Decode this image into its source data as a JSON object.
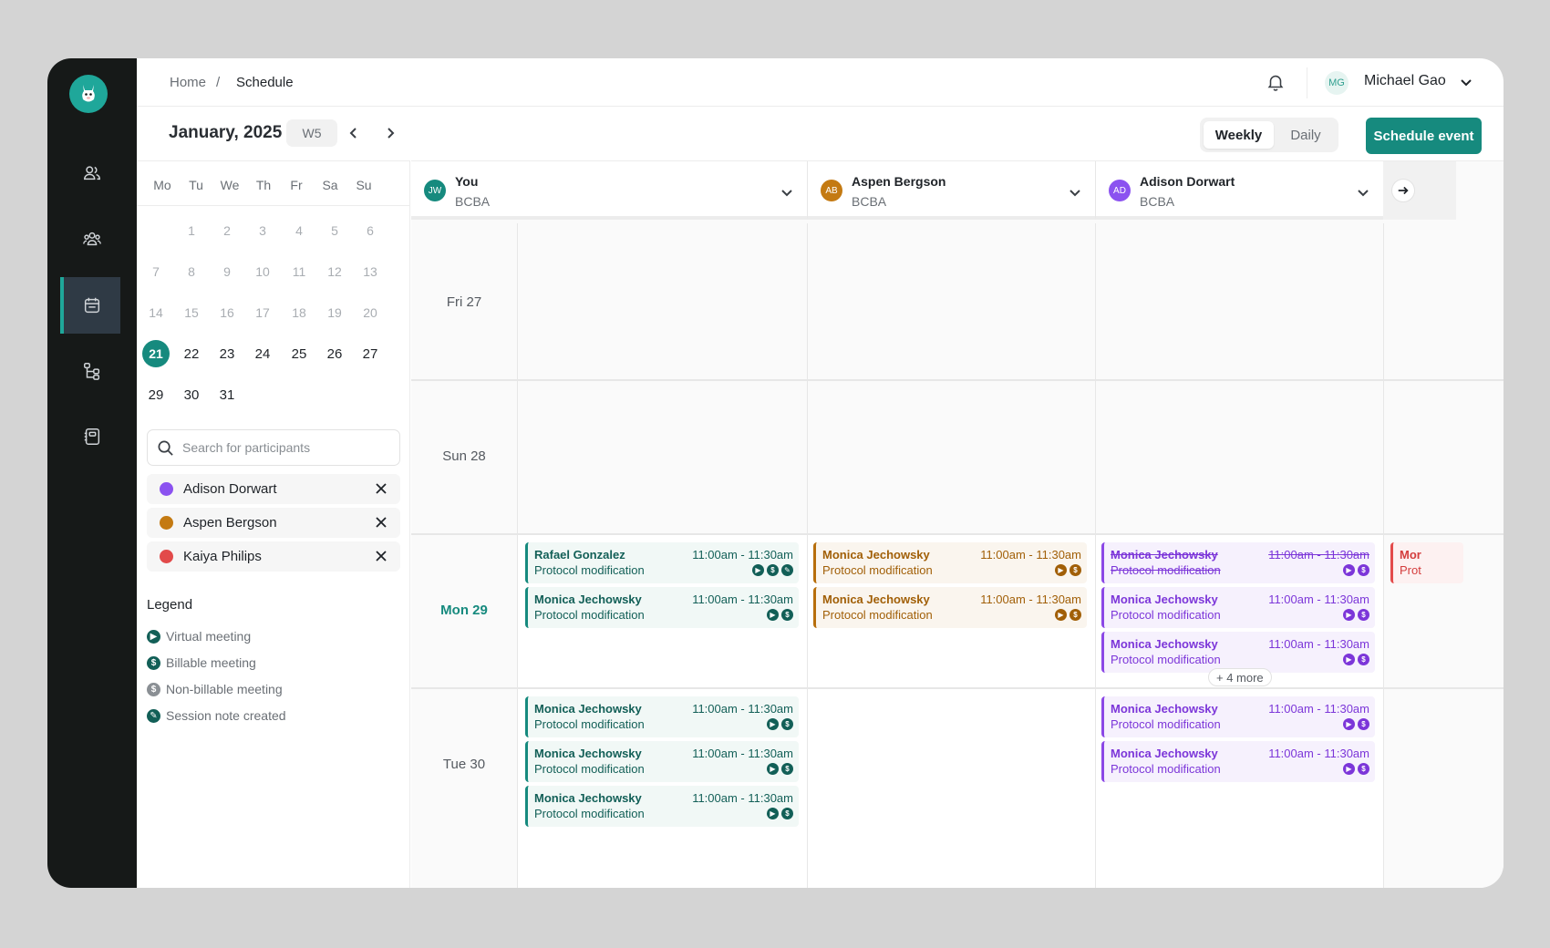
{
  "breadcrumb": {
    "home": "Home",
    "separator": "/",
    "current": "Schedule"
  },
  "user": {
    "initials": "MG",
    "name": "Michael Gao"
  },
  "toolbar": {
    "month": "January, 2025",
    "week": "W5",
    "view_weekly": "Weekly",
    "view_daily": "Daily",
    "schedule_button": "Schedule event"
  },
  "mini_calendar": {
    "weekdays": [
      "Mo",
      "Tu",
      "We",
      "Th",
      "Fr",
      "Sa",
      "Su"
    ],
    "past_days": [
      "1",
      "2",
      "3",
      "4",
      "5",
      "6",
      "7",
      "8",
      "9",
      "10",
      "11",
      "12",
      "13",
      "14",
      "15",
      "16",
      "17",
      "18",
      "19",
      "20"
    ],
    "selected_day": "21",
    "current_days": [
      "22",
      "23",
      "24",
      "25",
      "26",
      "27",
      "29",
      "30",
      "31"
    ]
  },
  "search": {
    "placeholder": "Search for participants"
  },
  "participants": [
    {
      "name": "Adison Dorwart",
      "color": "#8b52f0"
    },
    {
      "name": "Aspen Bergson",
      "color": "#c47a12"
    },
    {
      "name": "Kaiya Philips",
      "color": "#e24a4a"
    }
  ],
  "legend": {
    "title": "Legend",
    "items": [
      "Virtual meeting",
      "Billable meeting",
      "Non-billable meeting",
      "Session note created"
    ]
  },
  "columns": [
    {
      "initials": "JW",
      "name": "You",
      "role": "BCBA",
      "color": "#168a7e"
    },
    {
      "initials": "AB",
      "name": "Aspen Bergson",
      "role": "BCBA",
      "color": "#c47a12"
    },
    {
      "initials": "AD",
      "name": "Adison Dorwart",
      "role": "BCBA",
      "color": "#8b52f0"
    }
  ],
  "dates": [
    "Fri 27",
    "Sun 28",
    "Mon 29",
    "Tue 30"
  ],
  "events": {
    "you_mon_1": {
      "name": "Rafael Gonzalez",
      "desc": "Protocol modification",
      "time": "11:00am - 11:30am"
    },
    "you_mon_2": {
      "name": "Monica Jechowsky",
      "desc": "Protocol modification",
      "time": "11:00am - 11:30am"
    },
    "aspen_mon_1": {
      "name": "Monica Jechowsky",
      "desc": "Protocol modification",
      "time": "11:00am - 11:30am"
    },
    "aspen_mon_2": {
      "name": "Monica Jechowsky",
      "desc": "Protocol modification",
      "time": "11:00am - 11:30am"
    },
    "adison_mon_1": {
      "name": "Monica Jechowsky",
      "desc": "Protocol modification",
      "time": "11:00am - 11:30am"
    },
    "adison_mon_2": {
      "name": "Monica Jechowsky",
      "desc": "Protocol modification",
      "time": "11:00am - 11:30am"
    },
    "adison_mon_3": {
      "name": "Monica Jechowsky",
      "desc": "Protocol modification",
      "time": "11:00am - 11:30am"
    },
    "adison_more": "+ 4 more",
    "kaiya_mon_1": {
      "name": "Mor",
      "desc": "Prot"
    },
    "you_tue_1": {
      "name": "Monica Jechowsky",
      "desc": "Protocol modification",
      "time": "11:00am - 11:30am"
    },
    "you_tue_2": {
      "name": "Monica Jechowsky",
      "desc": "Protocol modification",
      "time": "11:00am - 11:30am"
    },
    "you_tue_3": {
      "name": "Monica Jechowsky",
      "desc": "Protocol modification",
      "time": "11:00am - 11:30am"
    },
    "adison_tue_1": {
      "name": "Monica Jechowsky",
      "desc": "Protocol modification",
      "time": "11:00am - 11:30am"
    },
    "adison_tue_2": {
      "name": "Monica Jechowsky",
      "desc": "Protocol modification",
      "time": "11:00am - 11:30am"
    }
  }
}
